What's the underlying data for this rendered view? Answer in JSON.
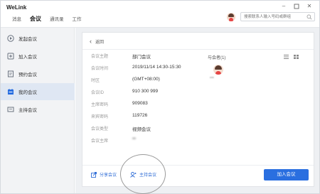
{
  "app": {
    "name": "WeLink"
  },
  "nav": {
    "tabs": [
      "消息",
      "会议",
      "通讯录",
      "工作"
    ],
    "active": "会议"
  },
  "search": {
    "placeholder": "搜索联系人输入号码或群组"
  },
  "window_controls": [
    "minimize",
    "maximize",
    "close"
  ],
  "sidebar": {
    "items": [
      {
        "label": "发起会议",
        "icon": "start-meeting-icon"
      },
      {
        "label": "加入会议",
        "icon": "join-meeting-icon"
      },
      {
        "label": "预约会议",
        "icon": "schedule-meeting-icon"
      },
      {
        "label": "我的会议",
        "icon": "my-meetings-icon"
      },
      {
        "label": "主持会议",
        "icon": "host-meeting-icon"
      }
    ],
    "active": "我的会议"
  },
  "detail": {
    "back_label": "返回",
    "fields": [
      {
        "key": "会议主题",
        "value": "部门会议"
      },
      {
        "key": "会议时间",
        "value": "2019/11/14 14:30-15:30"
      },
      {
        "key": "时区",
        "value": "(GMT+08:00)"
      },
      {
        "key": "会议ID",
        "value": "910 300 999"
      },
      {
        "key": "主席密码",
        "value": "909083"
      },
      {
        "key": "来宾密码",
        "value": "119726"
      },
      {
        "key": "会议类型",
        "value": "视频会议"
      },
      {
        "key": "会议主席",
        "value": "**"
      }
    ],
    "attendees_title": "与会者(1)",
    "attendee_name": "***",
    "share_label": "分享会议",
    "host_label": "主持会议",
    "join_label": "加入会议"
  },
  "colors": {
    "accent": "#2a6fe0",
    "sidebar_active": "#dfe7f3"
  }
}
